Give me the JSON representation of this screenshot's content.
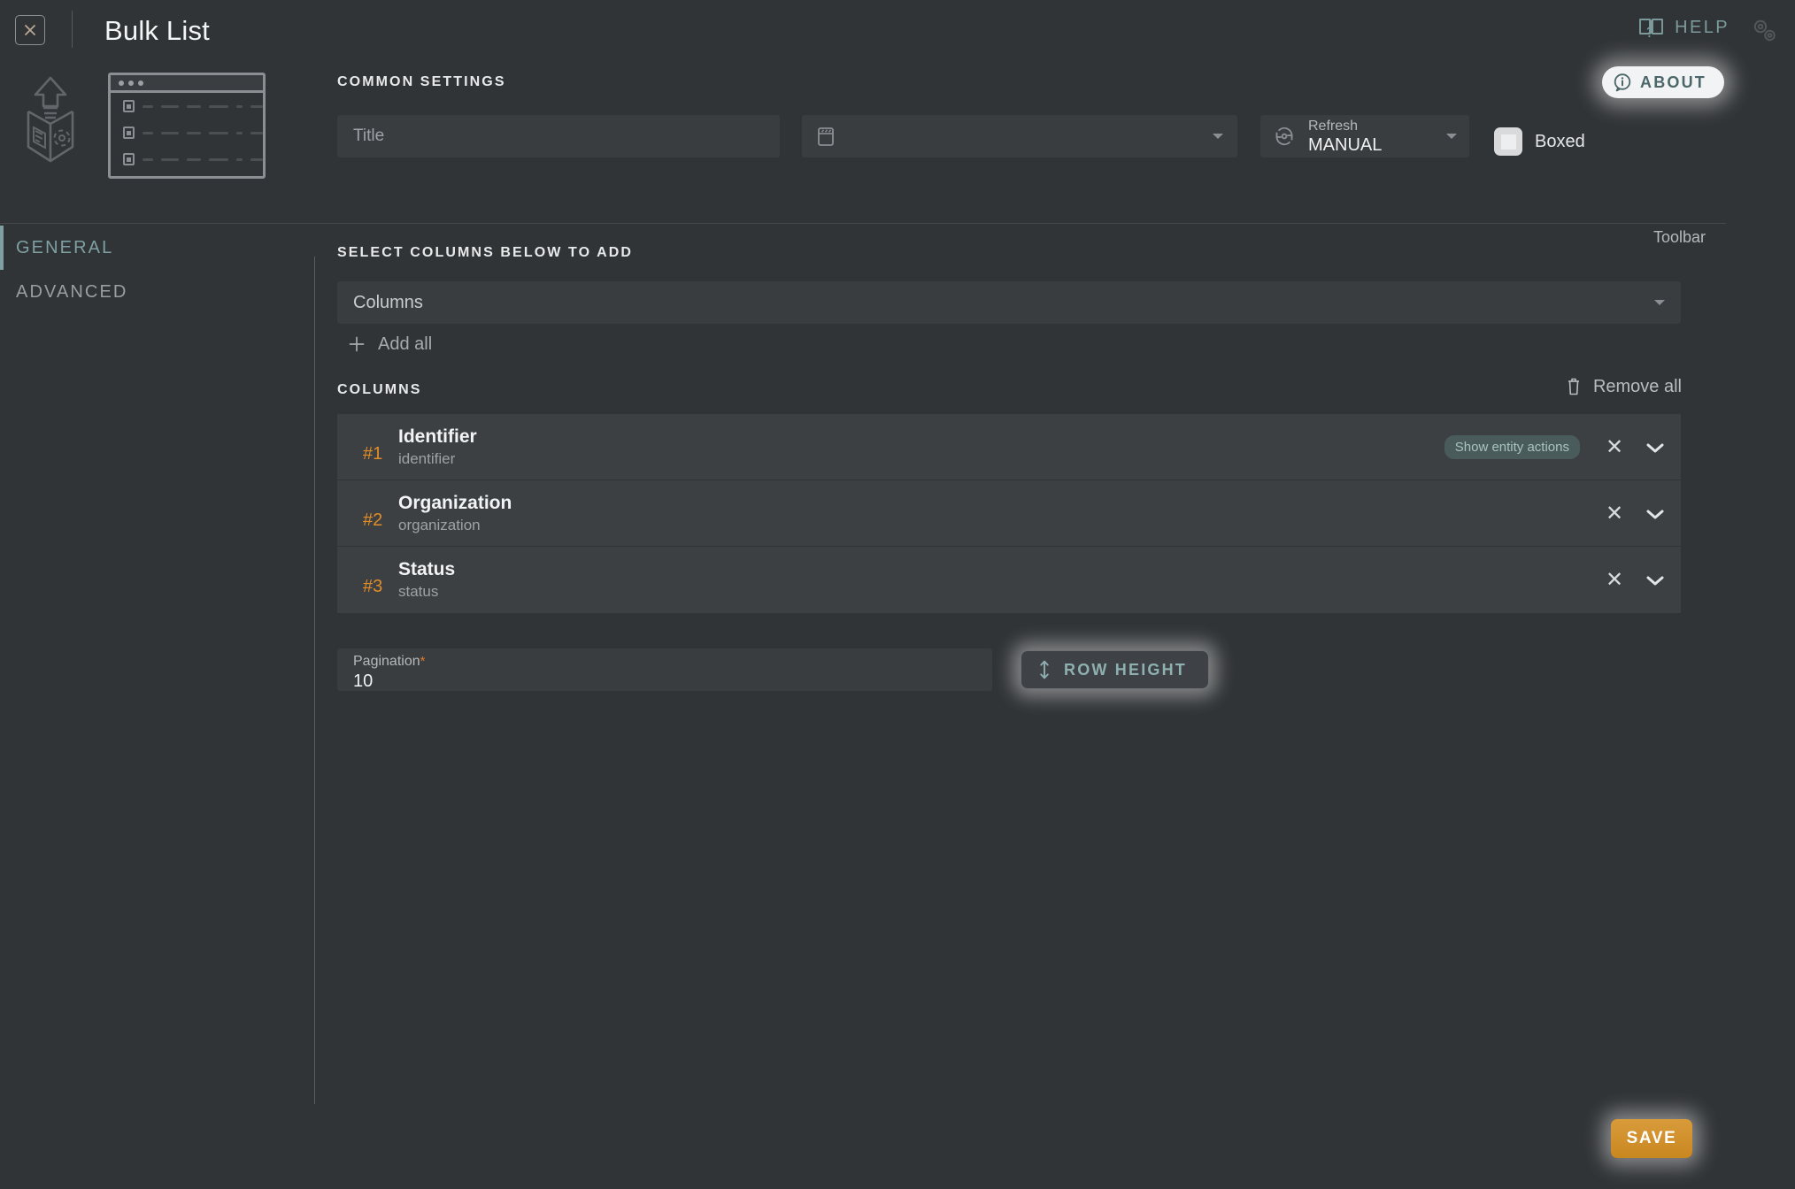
{
  "header": {
    "title": "Bulk List",
    "close_icon": "close-x-icon",
    "help_label": "HELP",
    "help_icon": "book-question-icon",
    "settings_icon": "gears-icon",
    "about_label": "ABOUT",
    "about_icon": "info-circle-icon"
  },
  "preview": {
    "cube_icon": "package-upload-icon",
    "window_icon": "list-window-preview-icon"
  },
  "common": {
    "section_title": "COMMON SETTINGS",
    "title_placeholder": "Title",
    "toolbar_label": "Toolbar",
    "toolbar_icon": "toolbar-icon",
    "toolbar_value": "",
    "refresh_label": "Refresh",
    "refresh_value": "MANUAL",
    "refresh_icon": "refresh-icon",
    "boxed_label": "Boxed",
    "boxed_checked": true
  },
  "sidebar": {
    "tabs": [
      {
        "label": "GENERAL",
        "active": true
      },
      {
        "label": "ADVANCED",
        "active": false
      }
    ]
  },
  "main": {
    "select_title": "SELECT COLUMNS BELOW TO ADD",
    "columns_placeholder": "Columns",
    "add_all_label": "Add all",
    "add_all_icon": "plus-icon",
    "columns_title": "COLUMNS",
    "remove_all_label": "Remove all",
    "remove_all_icon": "trash-icon",
    "columns": [
      {
        "index": "#1",
        "name": "Identifier",
        "key": "identifier",
        "tooltip": "Show entity actions"
      },
      {
        "index": "#2",
        "name": "Organization",
        "key": "organization",
        "tooltip": ""
      },
      {
        "index": "#3",
        "name": "Status",
        "key": "status",
        "tooltip": ""
      }
    ],
    "remove_icon": "close-x-icon",
    "expand_icon": "chevron-down-icon",
    "pagination_label": "Pagination",
    "pagination_required_marker": "*",
    "pagination_value": "10",
    "row_height_label": "ROW HEIGHT",
    "row_height_icon": "vertical-resize-icon"
  },
  "footer": {
    "save_label": "SAVE"
  },
  "colors": {
    "page_bg": "#313437",
    "field_bg": "#3a3d40",
    "row_bg": "#3d4043",
    "accent_teal": "#7fa0a2",
    "accent_orange": "#e08c28",
    "save_orange": "#c9871f",
    "text_primary": "#f2f3f4",
    "text_muted": "#9ea2a5"
  }
}
